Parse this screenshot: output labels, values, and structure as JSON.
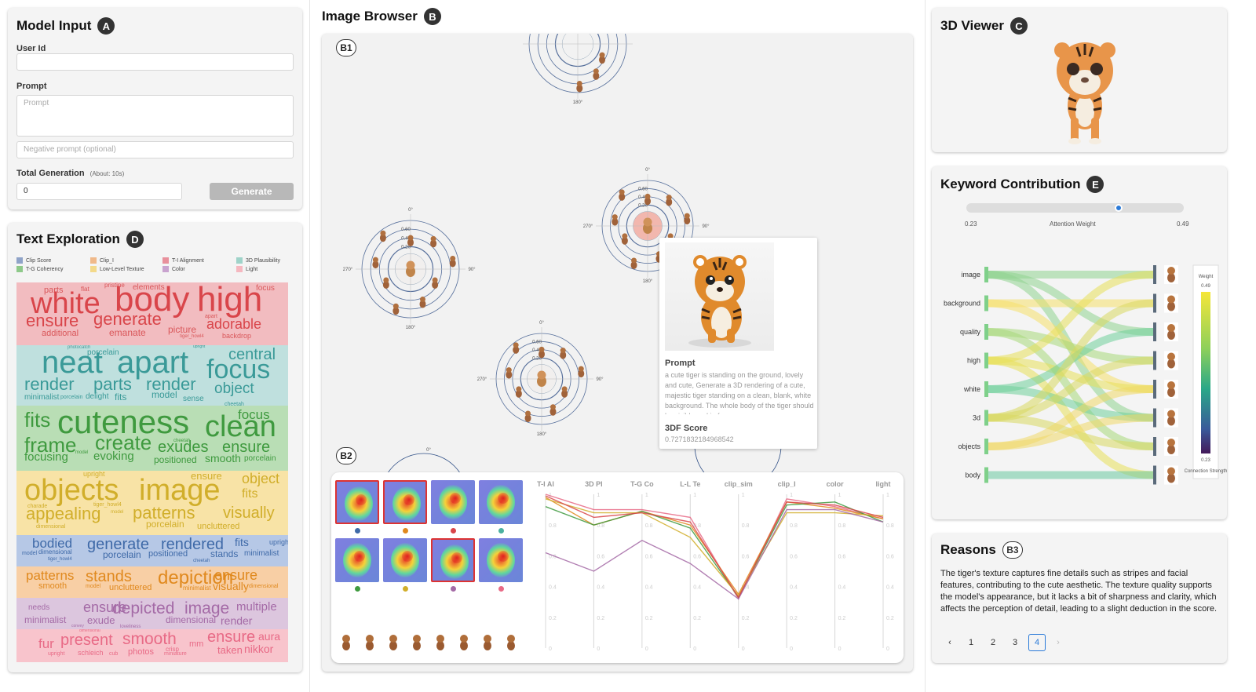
{
  "model_input": {
    "title": "Model Input",
    "badge": "A",
    "user_id_label": "User Id",
    "user_id_value": "",
    "prompt_label": "Prompt",
    "prompt_placeholder": "Prompt",
    "negative_placeholder": "Negative prompt (optional)",
    "total_label": "Total Generation",
    "total_hint": "(About: 10s)",
    "total_value": "0",
    "generate_label": "Generate"
  },
  "text_exploration": {
    "title": "Text Exploration",
    "badge": "D",
    "legend": [
      {
        "label": "Clip Score",
        "color": "#8fa3c8"
      },
      {
        "label": "Clip_I",
        "color": "#f0b98a"
      },
      {
        "label": "T-I Alignment",
        "color": "#e8909c"
      },
      {
        "label": "3D Plausibility",
        "color": "#9fd3c9"
      },
      {
        "label": "T-G Coherency",
        "color": "#8ec98a"
      },
      {
        "label": "Low-Level Texture",
        "color": "#f3d98a"
      },
      {
        "label": "Color",
        "color": "#c9a3cf"
      },
      {
        "label": "Light",
        "color": "#f5b8c0"
      }
    ],
    "bands": [
      {
        "words": [
          {
            "t": "parts",
            "c": "#d9575a"
          },
          {
            "t": "flat",
            "c": "#d9575a"
          },
          {
            "t": "pristine",
            "c": "#d9575a"
          },
          {
            "t": "elements",
            "c": "#d9575a"
          },
          {
            "t": "focus",
            "c": "#d9575a"
          },
          {
            "t": "white",
            "c": "#d9454a"
          },
          {
            "t": "body",
            "c": "#d9454a"
          },
          {
            "t": "high",
            "c": "#d9454a"
          },
          {
            "t": "ensure",
            "c": "#d9454a"
          },
          {
            "t": "generate",
            "c": "#d9454a"
          },
          {
            "t": "adorable",
            "c": "#d9454a"
          },
          {
            "t": "additional",
            "c": "#d9575a"
          },
          {
            "t": "emanate",
            "c": "#d9575a"
          },
          {
            "t": "picture",
            "c": "#d9575a"
          },
          {
            "t": "apart",
            "c": "#d9575a"
          },
          {
            "t": "tiger_howl4",
            "c": "#d9575a"
          },
          {
            "t": "backdrop",
            "c": "#d9575a"
          }
        ]
      },
      {
        "words": [
          {
            "t": "photocatch",
            "c": "#4a9a9a"
          },
          {
            "t": "neat",
            "c": "#3a9a98"
          },
          {
            "t": "apart",
            "c": "#3a9a98"
          },
          {
            "t": "central",
            "c": "#3a9a98"
          },
          {
            "t": "focus",
            "c": "#3a9a98"
          },
          {
            "t": "render",
            "c": "#3a9a98"
          },
          {
            "t": "parts",
            "c": "#3a9a98"
          },
          {
            "t": "render",
            "c": "#3a9a98"
          },
          {
            "t": "object",
            "c": "#3a9a98"
          },
          {
            "t": "minimalist",
            "c": "#3a9a98"
          },
          {
            "t": "porcelain",
            "c": "#3a9a98"
          },
          {
            "t": "delight",
            "c": "#3a9a98"
          },
          {
            "t": "fits",
            "c": "#3a9a98"
          },
          {
            "t": "model",
            "c": "#3a9a98"
          },
          {
            "t": "sense",
            "c": "#3a9a98"
          },
          {
            "t": "upright",
            "c": "#3a9a98"
          },
          {
            "t": "cheetah",
            "c": "#3a9a98"
          },
          {
            "t": "porcelain",
            "c": "#3a9a98"
          }
        ]
      },
      {
        "words": [
          {
            "t": "fits",
            "c": "#3f9a3f"
          },
          {
            "t": "cuteness",
            "c": "#3f9a3f"
          },
          {
            "t": "focus",
            "c": "#3f9a3f"
          },
          {
            "t": "clean",
            "c": "#3f9a3f"
          },
          {
            "t": "frame",
            "c": "#3f9a3f"
          },
          {
            "t": "create",
            "c": "#3f9a3f"
          },
          {
            "t": "cheetah",
            "c": "#3f9a3f"
          },
          {
            "t": "exudes",
            "c": "#3f9a3f"
          },
          {
            "t": "ensure",
            "c": "#3f9a3f"
          },
          {
            "t": "focusing",
            "c": "#3f9a3f"
          },
          {
            "t": "model",
            "c": "#3f9a3f"
          },
          {
            "t": "evoking",
            "c": "#3f9a3f"
          },
          {
            "t": "positioned",
            "c": "#3f9a3f"
          },
          {
            "t": "smooth",
            "c": "#3f9a3f"
          },
          {
            "t": "porcelain",
            "c": "#3f9a3f"
          }
        ]
      },
      {
        "words": [
          {
            "t": "upright",
            "c": "#d1ae2a"
          },
          {
            "t": "ensure",
            "c": "#d1ae2a"
          },
          {
            "t": "object",
            "c": "#d1ae2a"
          },
          {
            "t": "objects",
            "c": "#d1ae2a"
          },
          {
            "t": "image",
            "c": "#d1ae2a"
          },
          {
            "t": "fits",
            "c": "#d1ae2a"
          },
          {
            "t": "charade",
            "c": "#d1ae2a"
          },
          {
            "t": "tiger_howl4",
            "c": "#d1ae2a"
          },
          {
            "t": "appealing",
            "c": "#d1ae2a"
          },
          {
            "t": "model",
            "c": "#d1ae2a"
          },
          {
            "t": "patterns",
            "c": "#d1ae2a"
          },
          {
            "t": "visually",
            "c": "#d1ae2a"
          },
          {
            "t": "porcelain",
            "c": "#d1ae2a"
          },
          {
            "t": "dimensional",
            "c": "#d1ae2a"
          },
          {
            "t": "uncluttered",
            "c": "#d1ae2a"
          }
        ]
      },
      {
        "words": [
          {
            "t": "bodied",
            "c": "#3f6aa8"
          },
          {
            "t": "generate",
            "c": "#3f6aa8"
          },
          {
            "t": "rendered",
            "c": "#3f6aa8"
          },
          {
            "t": "fits",
            "c": "#3f6aa8"
          },
          {
            "t": "upright",
            "c": "#3f6aa8"
          },
          {
            "t": "model",
            "c": "#3f6aa8"
          },
          {
            "t": "dimensional",
            "c": "#3f6aa8"
          },
          {
            "t": "porcelain",
            "c": "#3f6aa8"
          },
          {
            "t": "positioned",
            "c": "#3f6aa8"
          },
          {
            "t": "stands",
            "c": "#3f6aa8"
          },
          {
            "t": "minimalist",
            "c": "#3f6aa8"
          },
          {
            "t": "tiger_howl4",
            "c": "#3f6aa8"
          },
          {
            "t": "cheetah",
            "c": "#3f6aa8"
          }
        ]
      },
      {
        "words": [
          {
            "t": "patterns",
            "c": "#e0891e"
          },
          {
            "t": "stands",
            "c": "#e0891e"
          },
          {
            "t": "depiction",
            "c": "#e0891e"
          },
          {
            "t": "ensure",
            "c": "#e0891e"
          },
          {
            "t": "smooth",
            "c": "#e0891e"
          },
          {
            "t": "model",
            "c": "#e0891e"
          },
          {
            "t": "uncluttered",
            "c": "#e0891e"
          },
          {
            "t": "minimalist",
            "c": "#e0891e"
          },
          {
            "t": "visually",
            "c": "#e0891e"
          },
          {
            "t": "dimensional",
            "c": "#e0891e"
          }
        ]
      },
      {
        "words": [
          {
            "t": "needs",
            "c": "#a46aa6"
          },
          {
            "t": "ensure",
            "c": "#a46aa6"
          },
          {
            "t": "depicted",
            "c": "#a46aa6"
          },
          {
            "t": "image",
            "c": "#a46aa6"
          },
          {
            "t": "multiple",
            "c": "#a46aa6"
          },
          {
            "t": "minimalist",
            "c": "#a46aa6"
          },
          {
            "t": "exude",
            "c": "#a46aa6"
          },
          {
            "t": "dimensional",
            "c": "#a46aa6"
          },
          {
            "t": "render",
            "c": "#a46aa6"
          },
          {
            "t": "convey",
            "c": "#a46aa6"
          },
          {
            "t": "loveliness",
            "c": "#a46aa6"
          }
        ]
      },
      {
        "words": [
          {
            "t": "dimensional",
            "c": "#e86a86"
          },
          {
            "t": "fur",
            "c": "#e86a86"
          },
          {
            "t": "present",
            "c": "#e86a86"
          },
          {
            "t": "smooth",
            "c": "#e86a86"
          },
          {
            "t": "ensure",
            "c": "#e86a86"
          },
          {
            "t": "aura",
            "c": "#e86a86"
          },
          {
            "t": "upright",
            "c": "#e86a86"
          },
          {
            "t": "schleich",
            "c": "#e86a86"
          },
          {
            "t": "cub",
            "c": "#e86a86"
          },
          {
            "t": "photos",
            "c": "#e86a86"
          },
          {
            "t": "crisp",
            "c": "#e86a86"
          },
          {
            "t": "mm",
            "c": "#e86a86"
          },
          {
            "t": "taken",
            "c": "#e86a86"
          },
          {
            "t": "nikkor",
            "c": "#e86a86"
          },
          {
            "t": "miniature",
            "c": "#e86a86"
          }
        ]
      }
    ]
  },
  "image_browser": {
    "title": "Image Browser",
    "badge": "B",
    "b1": "B1",
    "b2": "B2",
    "angles": {
      "a0": "0°",
      "a90": "90°",
      "a180": "180°",
      "a270": "270°"
    },
    "ring_ticks": [
      "0.20",
      "0.40",
      "0.60"
    ],
    "tooltip": {
      "prompt_label": "Prompt",
      "prompt_text": "a cute tiger is standing on the ground, lovely and cute, Generate a 3D rendering of a cute, majestic tiger standing on a clean, blank, white background. The whole body of the tiger should be visible and in frame",
      "score_label": "3DF Score",
      "score_value": "0.7271832184968542"
    },
    "heatmaps": [
      {
        "selected": true,
        "dot": "#3f6aa8"
      },
      {
        "selected": true,
        "dot": "#e0891e"
      },
      {
        "selected": false,
        "dot": "#d9454a"
      },
      {
        "selected": false,
        "dot": "#4bb0a0"
      },
      {
        "selected": false,
        "dot": "#3f9a3f"
      },
      {
        "selected": false,
        "dot": "#d1ae2a"
      },
      {
        "selected": true,
        "dot": "#a46aa6"
      },
      {
        "selected": false,
        "dot": "#e86a86"
      }
    ],
    "parallel": {
      "axes": [
        "T-I Al",
        "3D Pl",
        "T-G Co",
        "L-L Te",
        "clip_sim",
        "clip_I",
        "color",
        "light"
      ],
      "ticks": [
        "1",
        "0.8",
        "0.6",
        "0.4",
        "0.2",
        "0"
      ]
    }
  },
  "chart_data": {
    "type": "line",
    "title": "",
    "x": [
      "T-I Al",
      "3D Pl",
      "T-G Co",
      "L-L Te",
      "clip_sim",
      "clip_I",
      "color",
      "light"
    ],
    "ylim": [
      0,
      1
    ],
    "series": [
      {
        "color": "#e86a86",
        "values": [
          1.0,
          0.9,
          0.9,
          0.85,
          0.32,
          0.97,
          0.92,
          0.84
        ]
      },
      {
        "color": "#e0891e",
        "values": [
          0.98,
          0.8,
          0.89,
          0.8,
          0.35,
          0.95,
          0.91,
          0.84
        ]
      },
      {
        "color": "#3f9a3f",
        "values": [
          0.92,
          0.8,
          0.89,
          0.78,
          0.33,
          0.93,
          0.95,
          0.82
        ]
      },
      {
        "color": "#d1ae2a",
        "values": [
          0.97,
          0.88,
          0.88,
          0.72,
          0.34,
          0.88,
          0.88,
          0.86
        ]
      },
      {
        "color": "#a46aa6",
        "values": [
          0.62,
          0.5,
          0.7,
          0.55,
          0.32,
          0.9,
          0.9,
          0.82
        ]
      },
      {
        "color": "#d9454a",
        "values": [
          0.99,
          0.85,
          0.88,
          0.82,
          0.33,
          0.95,
          0.93,
          0.85
        ]
      }
    ]
  },
  "viewer": {
    "title": "3D Viewer",
    "badge": "C"
  },
  "keyword": {
    "title": "Keyword Contribution",
    "badge": "E",
    "slider_min": "0.23",
    "slider_max": "0.49",
    "slider_label": "Attention Weight",
    "slider_value": 0.7,
    "keywords": [
      "image",
      "background",
      "quality",
      "high",
      "white",
      "3d",
      "objects",
      "body"
    ],
    "colorbar_top": "Weight",
    "colorbar_hi": "0.49",
    "colorbar_lo": "0.23",
    "colorbar_bottom": "Connection Strength"
  },
  "reasons": {
    "title": "Reasons",
    "badge": "B3",
    "text": "The tiger's texture captures fine details such as stripes and facial features, contributing to the cute aesthetic. The texture quality supports the model's appearance, but it lacks a bit of sharpness and clarity, which affects the perception of detail, leading to a slight deduction in the score.",
    "pages": [
      "1",
      "2",
      "3",
      "4"
    ],
    "prev": "‹",
    "next": "›"
  }
}
